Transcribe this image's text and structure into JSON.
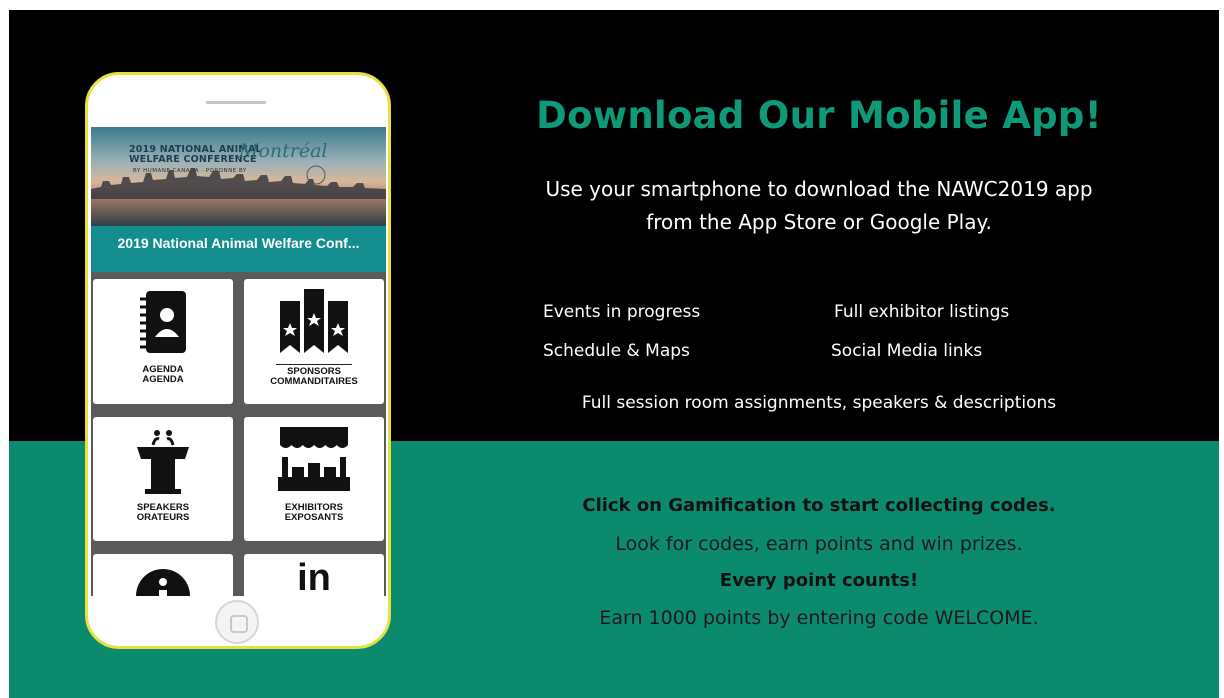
{
  "promo": {
    "heading": "Download Our Mobile App!",
    "intro_line1": "Use your smartphone to download the NAWC2019 app",
    "intro_line2": "from the App Store or Google Play.",
    "features": [
      "Events in progress",
      "Full exhibitor listings",
      "Schedule & Maps",
      "Social Media links"
    ],
    "feature_wide": "Full session room assignments, speakers & descriptions",
    "gamification": {
      "line1": "Click on Gamification to start collecting codes.",
      "line2": "Look for codes, earn points and win prizes.",
      "line3": "Every point counts!",
      "line4": "Earn 1000 points by entering code WELCOME."
    }
  },
  "phone": {
    "banner": {
      "title_line1": "2019 NATIONAL ANIMAL",
      "title_line2": "WELFARE CONFERENCE",
      "script": "Montréal",
      "subtitle": "BY HUMANE CANADA · PORONNE BY"
    },
    "app_title": "2019 National Animal Welfare Conf...",
    "tiles": {
      "agenda": {
        "en": "AGENDA",
        "fr": "AGENDA"
      },
      "sponsors": {
        "en": "SPONSORS",
        "fr": "COMMANDITAIRES"
      },
      "speakers": {
        "en": "SPEAKERS",
        "fr": "ORATEURS"
      },
      "exhibitors": {
        "en": "EXHIBITORS",
        "fr": "EXPOSANTS"
      },
      "linkedin": {
        "glyph": "in"
      }
    }
  },
  "colors": {
    "black_band": "#000000",
    "green_band": "#0b8a6e",
    "heading_green": "#0e9a78",
    "phone_border": "#e6e040",
    "app_bar_teal": "#138d8d"
  }
}
